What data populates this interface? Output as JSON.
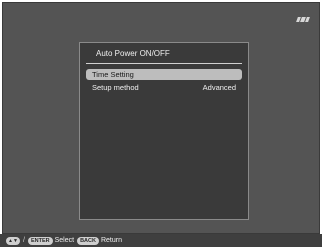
{
  "dialog": {
    "title": "Auto Power ON/OFF",
    "items": [
      {
        "label": "Time Setting",
        "value": ""
      },
      {
        "label": "Setup method",
        "value": "Advanced"
      }
    ]
  },
  "statusbar": {
    "arrows_icon": "up-down-arrows-icon",
    "slash": "/",
    "enter_key": "ENTER",
    "select_label": "Select",
    "back_key": "BACK",
    "return_label": "Return"
  },
  "colors": {
    "screen_background": "#545454",
    "dialog_background": "#3a3a3a",
    "highlight": "#bdbdbd",
    "statusbar": "#3f3f3f"
  }
}
